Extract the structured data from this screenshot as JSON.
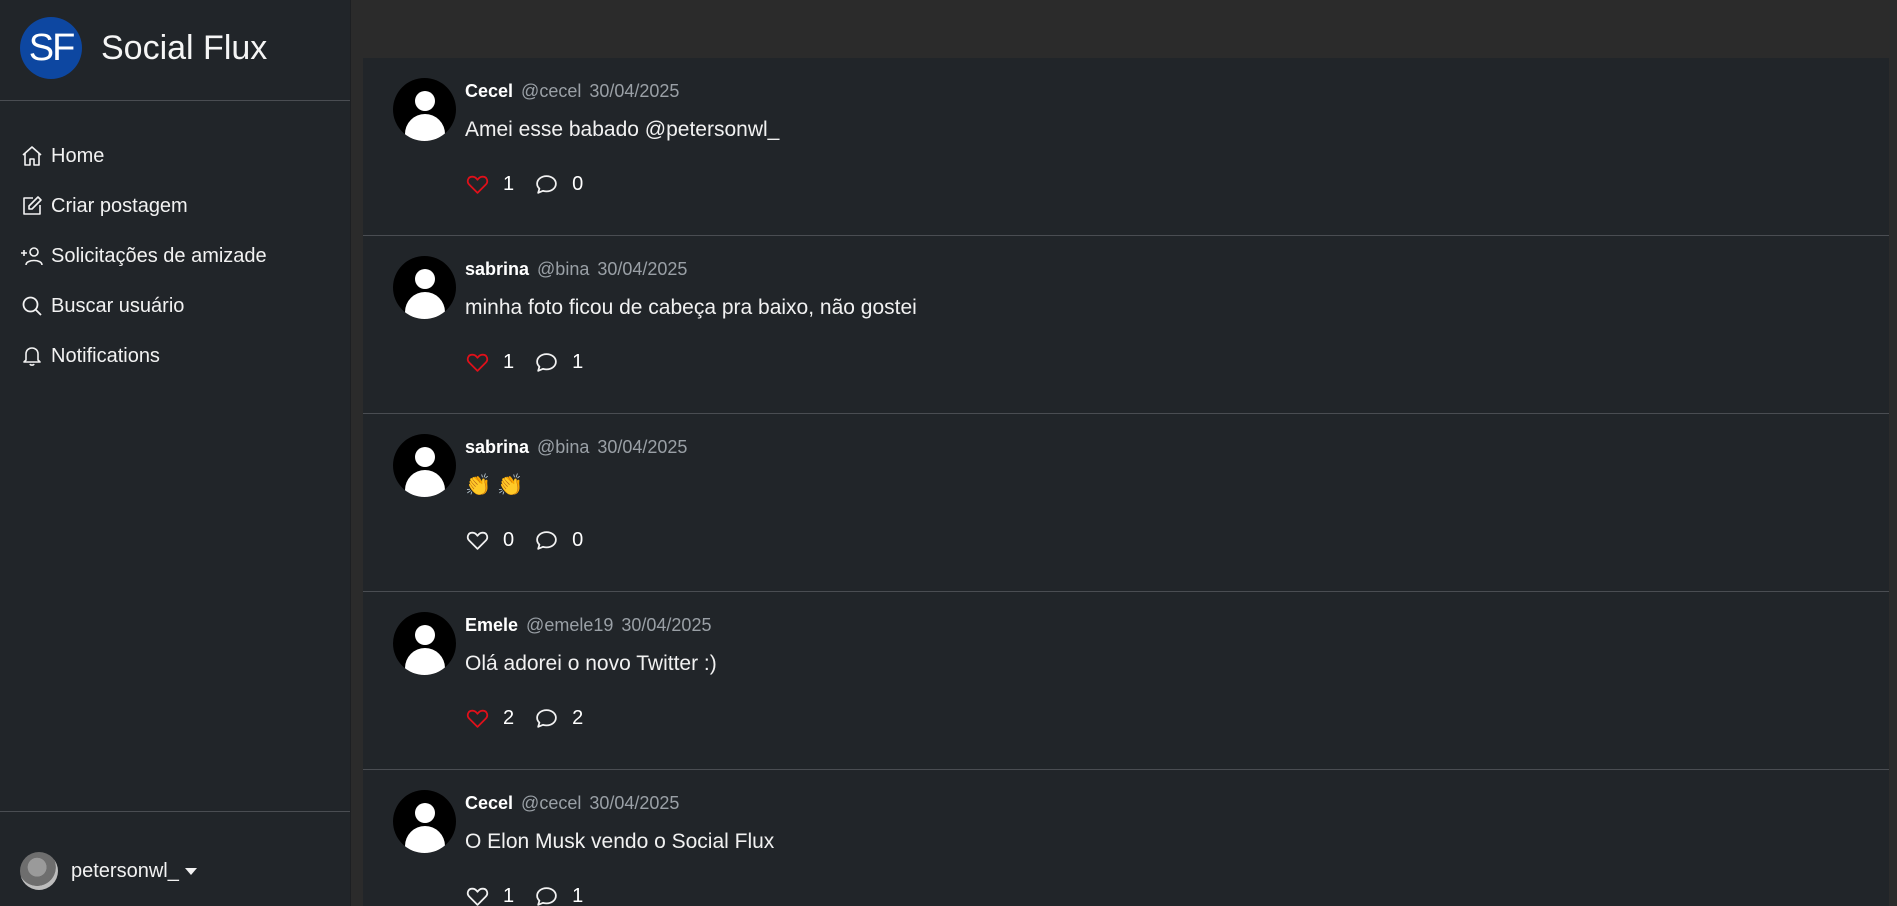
{
  "brand": {
    "logo_text": "SF",
    "name": "Social Flux",
    "logo_color": "#0d47a1"
  },
  "nav": [
    {
      "label": "Home",
      "icon": "home-icon"
    },
    {
      "label": "Criar postagem",
      "icon": "edit-icon"
    },
    {
      "label": "Solicitações de amizade",
      "icon": "add-user-icon"
    },
    {
      "label": "Buscar usuário",
      "icon": "search-icon"
    },
    {
      "label": "Notifications",
      "icon": "bell-icon"
    }
  ],
  "user": {
    "name": "petersonwl_"
  },
  "colors": {
    "like_active": "#e0101a",
    "background": "#212529",
    "muted": "#9aa0a6"
  },
  "posts": [
    {
      "author": "Cecel",
      "handle": "@cecel",
      "date": "30/04/2025",
      "text": "Amei esse babado @petersonwl_",
      "likes": "1",
      "comments": "0",
      "liked": true
    },
    {
      "author": "sabrina",
      "handle": "@bina",
      "date": "30/04/2025",
      "text": "minha foto ficou de cabeça pra baixo, não gostei",
      "likes": "1",
      "comments": "1",
      "liked": true
    },
    {
      "author": "sabrina",
      "handle": "@bina",
      "date": "30/04/2025",
      "text": "👏 👏",
      "likes": "0",
      "comments": "0",
      "liked": false
    },
    {
      "author": "Emele",
      "handle": "@emele19",
      "date": "30/04/2025",
      "text": "Olá adorei o novo Twitter :)",
      "likes": "2",
      "comments": "2",
      "liked": true
    },
    {
      "author": "Cecel",
      "handle": "@cecel",
      "date": "30/04/2025",
      "text": "O Elon Musk vendo o Social Flux",
      "likes": "1",
      "comments": "1",
      "liked": false
    }
  ]
}
